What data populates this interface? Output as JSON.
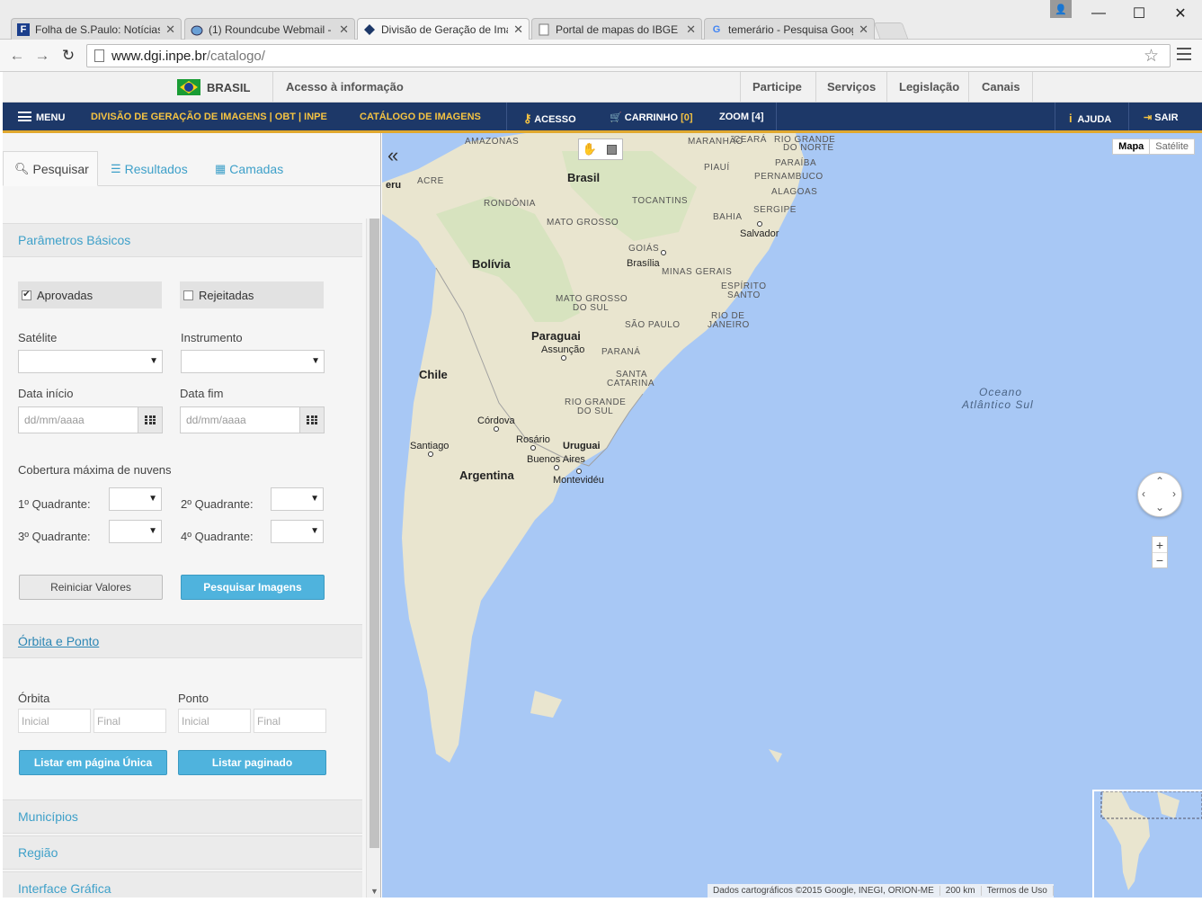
{
  "browser": {
    "tabs": [
      {
        "label": "Folha de S.Paulo: Notícias",
        "favicon": "F"
      },
      {
        "label": "(1) Roundcube Webmail -",
        "favicon": "rc"
      },
      {
        "label": "Divisão de Geração de Ima",
        "favicon": "dgi"
      },
      {
        "label": "Portal de mapas do IBGE",
        "favicon": "page"
      },
      {
        "label": "temerário - Pesquisa Goog",
        "favicon": "G"
      }
    ],
    "url_host": "www.dgi.inpe.br",
    "url_path": "/catalogo/"
  },
  "govbar": {
    "country": "BRASIL",
    "access": "Acesso à informação",
    "links": [
      "Participe",
      "Serviços",
      "Legislação",
      "Canais"
    ]
  },
  "appbar": {
    "menu": "MENU",
    "division": "DIVISÃO DE GERAÇÃO DE IMAGENS | OBT | INPE",
    "catalog": "CATÁLOGO DE IMAGENS",
    "access": "ACESSO",
    "cart": "CARRINHO",
    "cart_count": "[0]",
    "zoom": "ZOOM [4]",
    "help": "AJUDA",
    "logout": "SAIR"
  },
  "panel": {
    "tabs": [
      "Pesquisar",
      "Resultados",
      "Camadas"
    ],
    "basic_params": "Parâmetros Básicos",
    "approved": "Aprovadas",
    "rejected": "Rejeitadas",
    "satellite": "Satélite",
    "instrument": "Instrumento",
    "date_start": "Data início",
    "date_end": "Data fim",
    "date_placeholder": "dd/mm/aaaa",
    "cloud_cover": "Cobertura máxima de nuvens",
    "q1": "1º Quadrante:",
    "q2": "2º Quadrante:",
    "q3": "3º Quadrante:",
    "q4": "4º Quadrante:",
    "reset_btn": "Reiniciar Valores",
    "search_btn": "Pesquisar Imagens",
    "orbit_point": "Órbita e Ponto",
    "orbit": "Órbita",
    "point": "Ponto",
    "initial": "Inicial",
    "final": "Final",
    "list_single": "Listar em página Única",
    "list_paged": "Listar paginado",
    "municipios": "Municípios",
    "regiao": "Região",
    "interface": "Interface Gráfica"
  },
  "map": {
    "type_map": "Mapa",
    "type_sat": "Satélite",
    "attribution": "Dados cartográficos ©2015 Google, INEGI, ORION-ME",
    "scale": "200 km",
    "terms": "Termos de Uso",
    "labels": {
      "amazonas": "AMAZONAS",
      "maranhao": "MARANHÃO",
      "ceara": "CEARÁ",
      "rgn1": "RIO GRANDE",
      "rgn2": "DO NORTE",
      "paraiba": "PARAÍBA",
      "piaui": "PIAUÍ",
      "pernambuco": "PERNAMBUCO",
      "alagoas": "ALAGOAS",
      "acre": "ACRE",
      "rondonia": "RONDÔNIA",
      "tocantins": "TOCANTINS",
      "bahia": "BAHIA",
      "sergipe": "SERGIPE",
      "matogrosso": "MATO GROSSO",
      "goias": "GOIÁS",
      "minas": "MINAS GERAIS",
      "es1": "ESPÍRITO",
      "es2": "SANTO",
      "ms1": "MATO GROSSO",
      "ms2": "DO SUL",
      "rj1": "RIO DE",
      "rj2": "JANEIRO",
      "sp": "SÃO PAULO",
      "parana": "PARANÁ",
      "sc1": "SANTA",
      "sc2": "CATARINA",
      "rs1": "RIO GRANDE",
      "rs2": "DO SUL",
      "brasil": "Brasil",
      "bolivia": "Bolívia",
      "paraguai": "Paraguai",
      "chile": "Chile",
      "argentina": "Argentina",
      "uruguai": "Uruguai",
      "salvador": "Salvador",
      "brasilia": "Brasília",
      "assuncao": "Assunção",
      "cordova": "Córdova",
      "santiago": "Santiago",
      "rosario": "Rosário",
      "buenosaires": "Buenos Aires",
      "montevideu": "Montevidéu",
      "ocean1": "Oceano",
      "ocean2": "Atlântico Sul",
      "peru": "eru"
    }
  }
}
